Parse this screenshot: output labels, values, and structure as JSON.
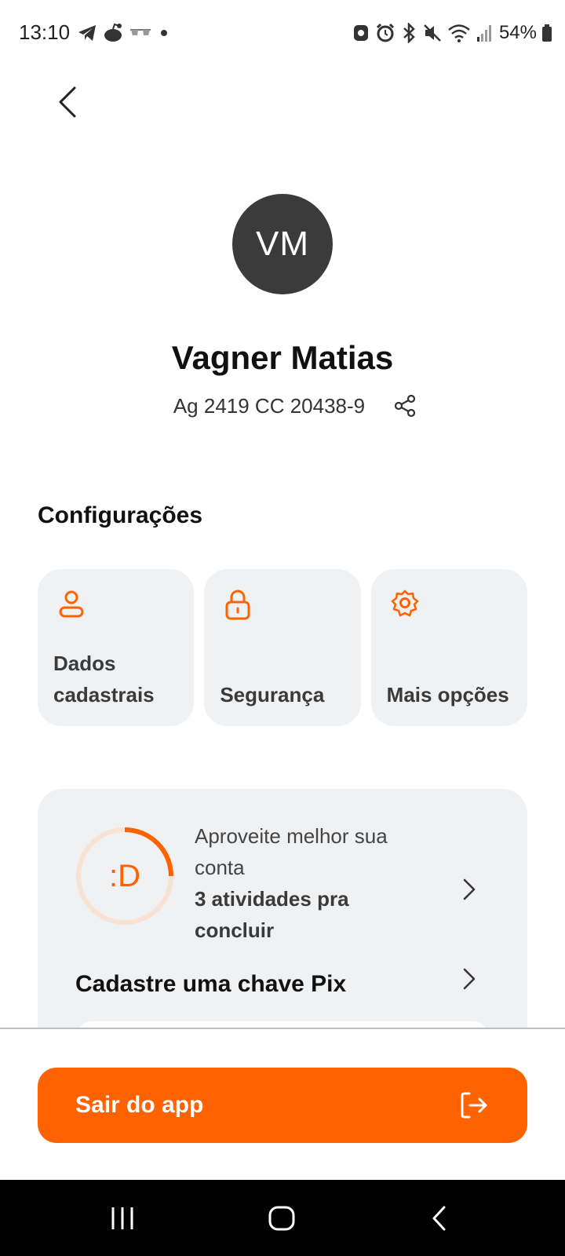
{
  "status_bar": {
    "time": "13:10",
    "battery": "54%",
    "left_icons": [
      "telegram-icon",
      "reddit-icon",
      "glasses-icon",
      "dot-icon"
    ],
    "right_icons": [
      "nfc-icon",
      "alarm-icon",
      "bluetooth-icon",
      "mute-icon",
      "wifi-icon",
      "signal-icon",
      "battery-icon"
    ]
  },
  "header": {
    "back_icon": "chevron-left-icon"
  },
  "profile": {
    "initials": "VM",
    "name": "Vagner Matias",
    "account": "Ag 2419 CC 20438-9",
    "share_icon": "share-icon"
  },
  "settings": {
    "title": "Configurações",
    "cards": [
      {
        "line1": "Dados",
        "line2": "cadastrais",
        "icon": "user-icon"
      },
      {
        "line1": "",
        "line2": "Segurança",
        "icon": "lock-icon"
      },
      {
        "line1": "",
        "line2": "Mais opções",
        "icon": "gear-icon"
      }
    ]
  },
  "activities": {
    "emoticon": ":D",
    "line1": "Aproveite melhor sua",
    "line2": "conta",
    "strong1": "3 atividades pra",
    "strong2": "concluir",
    "progress_fraction": 0.25,
    "pix_label": "Cadastre uma chave Pix"
  },
  "logout": {
    "label": "Sair do app",
    "icon": "logout-icon"
  },
  "nav": {
    "icons": [
      "recent-apps-icon",
      "home-icon",
      "back-icon"
    ]
  },
  "colors": {
    "accent": "#ff6200",
    "card_bg": "#f0f1f3",
    "avatar_bg": "#3b3b3b"
  }
}
